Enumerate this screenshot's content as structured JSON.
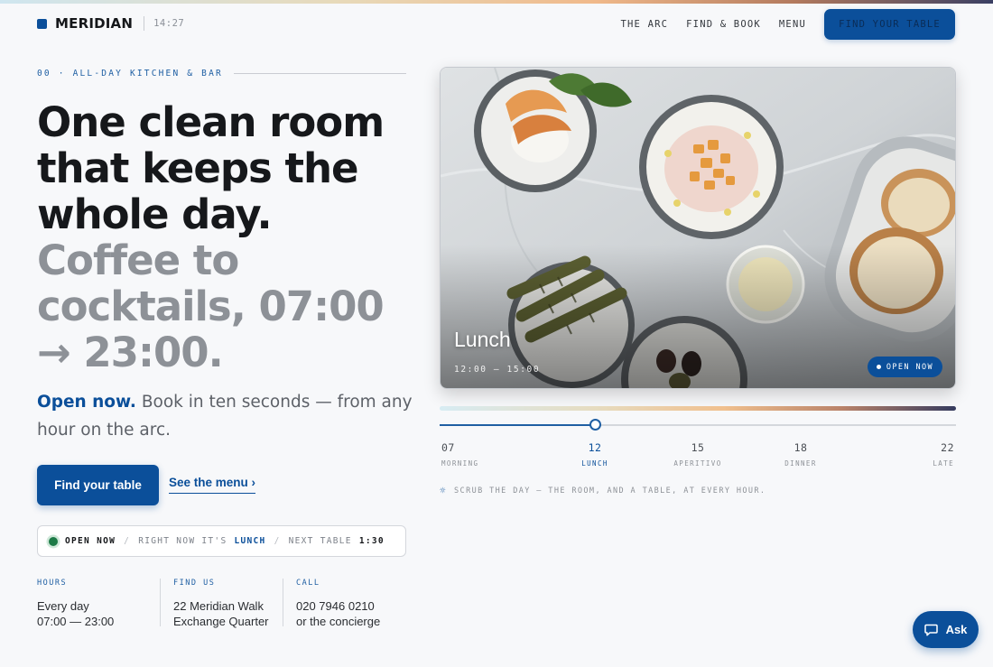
{
  "header": {
    "brand": "MERIDIAN",
    "time": "14:27",
    "nav": [
      "THE ARC",
      "FIND & BOOK",
      "MENU"
    ],
    "cta": "FIND YOUR TABLE"
  },
  "intro": {
    "eyebrow": "00 · ALL-DAY KITCHEN & BAR",
    "headline_dark": [
      "One clean room",
      "that keeps the",
      "whole day."
    ],
    "headline_light": [
      "Coffee to",
      "cocktails, 07:00",
      "→ 23:00."
    ],
    "lede_accent": "Open now.",
    "lede_rest": " Book in ten seconds — from any hour on the arc.",
    "primary_cta": "Find your table",
    "secondary_cta": "See the menu ›"
  },
  "status": {
    "open": "OPEN NOW",
    "right_now": "RIGHT NOW IT'S",
    "meal": "LUNCH",
    "next_table": "NEXT TABLE",
    "next_time": "1:30"
  },
  "info": [
    {
      "label": "HOURS",
      "lines": [
        "Every day",
        "07:00 — 23:00"
      ]
    },
    {
      "label": "FIND US",
      "lines": [
        "22 Meridian Walk",
        "Exchange Quarter"
      ]
    },
    {
      "label": "CALL",
      "lines": [
        "020 7946 0210",
        "or the concierge"
      ]
    }
  ],
  "hero": {
    "title": "Lunch",
    "time": "12:00 — 15:00",
    "badge": "OPEN NOW"
  },
  "arc": {
    "progress": 0.3,
    "active_index": 1,
    "ticks": [
      {
        "hour": "07",
        "label": "MORNING"
      },
      {
        "hour": "12",
        "label": "LUNCH"
      },
      {
        "hour": "15",
        "label": "APERITIVO"
      },
      {
        "hour": "18",
        "label": "DINNER"
      },
      {
        "hour": "22",
        "label": "LATE"
      }
    ],
    "hint": "SCRUB THE DAY — THE ROOM, AND A TABLE, AT EVERY HOUR."
  },
  "ask": {
    "label": "Ask"
  },
  "colors": {
    "accent": "#0b4f9a",
    "open_dot": "#1d7a47"
  }
}
